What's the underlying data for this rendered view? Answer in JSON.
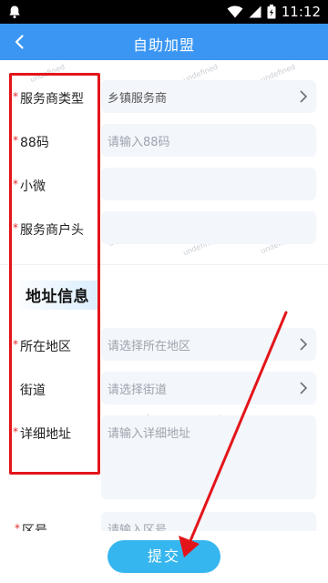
{
  "status": {
    "time": "11:12"
  },
  "nav": {
    "title": "自助加盟"
  },
  "form": {
    "rows": [
      {
        "label": "服务商类型",
        "required": true,
        "value": "乡镇服务商",
        "placeholder": ""
      },
      {
        "label": "88码",
        "required": true,
        "value": "",
        "placeholder": "请输入88码"
      },
      {
        "label": "小微",
        "required": true,
        "value": "",
        "placeholder": ""
      },
      {
        "label": "服务商户头",
        "required": true,
        "value": "",
        "placeholder": ""
      }
    ],
    "section_title": "地址信息",
    "address_rows": [
      {
        "label": "所在地区",
        "required": true,
        "placeholder": "请选择所在地区"
      },
      {
        "label": "街道",
        "required": false,
        "placeholder": "请选择街道"
      },
      {
        "label": "详细地址",
        "required": true,
        "placeholder": "请输入详细地址"
      }
    ],
    "partial_row": {
      "label": "区号",
      "required": true,
      "placeholder": "请输入区号"
    },
    "required_mark": "*",
    "watermark": "undefined"
  },
  "submit": {
    "label": "提交"
  },
  "colors": {
    "nav": "#3b96f3",
    "submit": "#36b6ee",
    "annotation": "#e3151a",
    "required": "#e62b2b"
  }
}
